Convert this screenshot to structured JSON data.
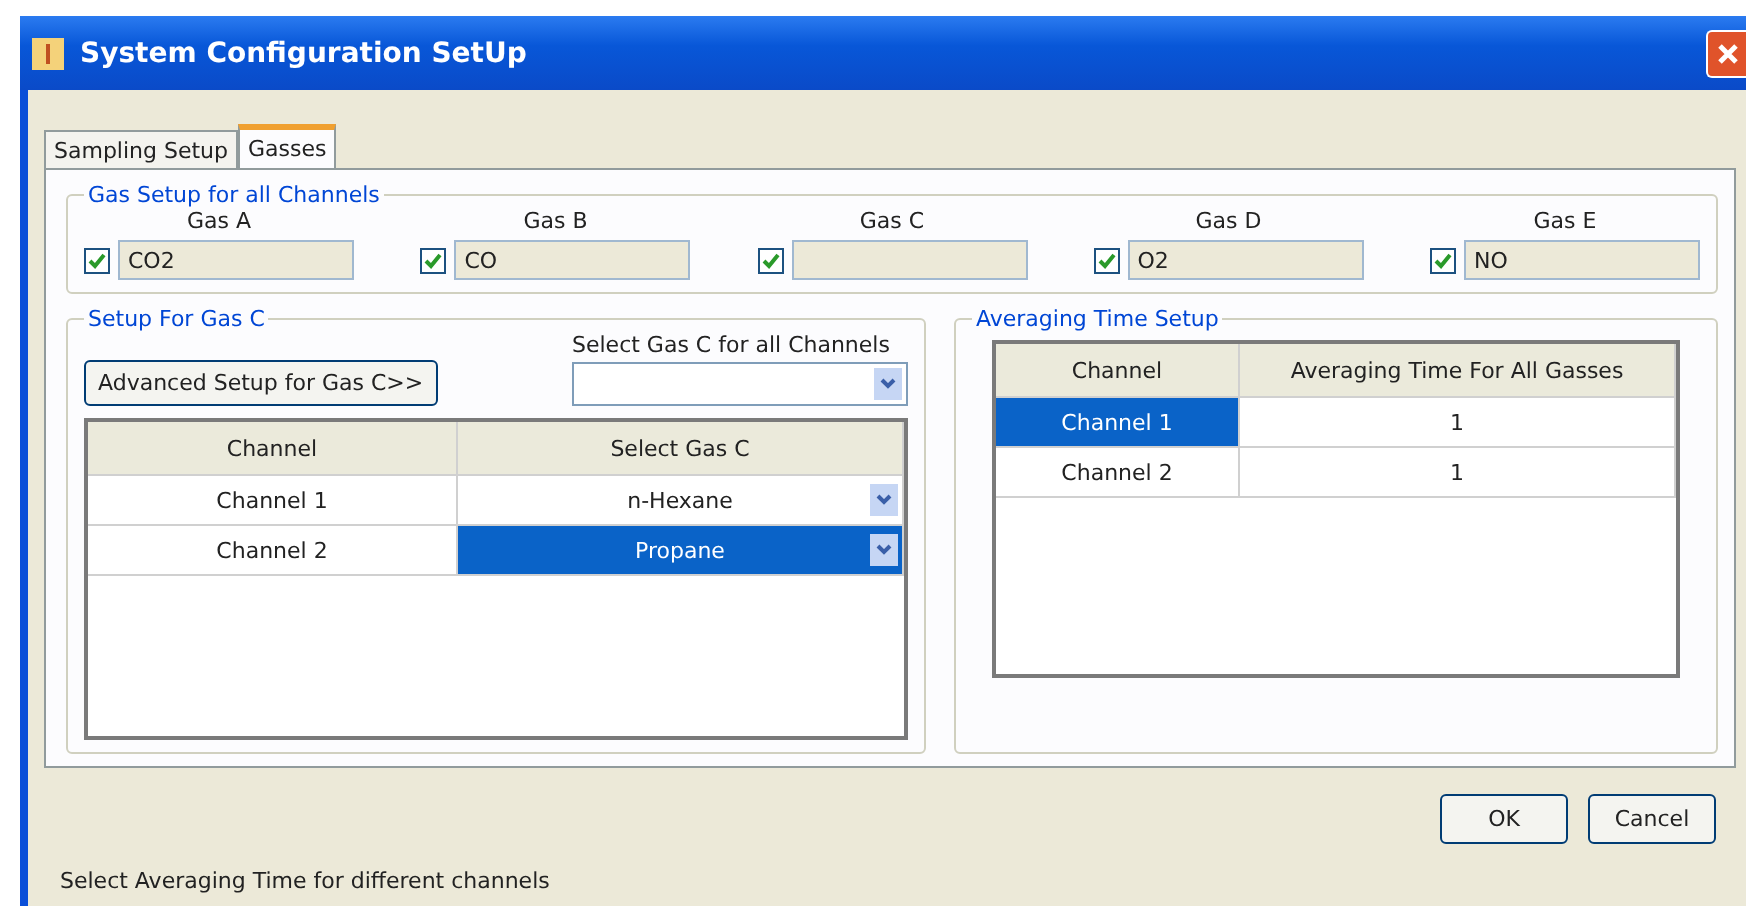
{
  "window": {
    "title": "System Configuration SetUp"
  },
  "tabs": [
    {
      "label": "Sampling Setup",
      "selected": false
    },
    {
      "label": "Gasses",
      "selected": true
    }
  ],
  "gas_setup": {
    "title": "Gas Setup for all Channels",
    "gases": [
      {
        "label": "Gas A",
        "checked": true,
        "value": "CO2"
      },
      {
        "label": "Gas B",
        "checked": true,
        "value": "CO"
      },
      {
        "label": "Gas C",
        "checked": true
      },
      {
        "label": "Gas D",
        "checked": true,
        "value": "O2"
      },
      {
        "label": "Gas E",
        "checked": true,
        "value": "NO"
      }
    ]
  },
  "gas_c_setup": {
    "title": "Setup For Gas C",
    "advanced_button": "Advanced Setup for Gas C>>",
    "select_all_label": "Select Gas C for all Channels",
    "table": {
      "columns": [
        "Channel",
        "Select Gas C"
      ],
      "rows": [
        {
          "channel": "Channel 1",
          "gas": "n-Hexane",
          "selected": false
        },
        {
          "channel": "Channel 2",
          "gas": "Propane",
          "selected": true
        }
      ]
    }
  },
  "averaging": {
    "title": "Averaging Time Setup",
    "table": {
      "columns": [
        "Channel",
        "Averaging Time For All Gasses"
      ],
      "rows": [
        {
          "channel": "Channel 1",
          "time": "1",
          "selected": true
        },
        {
          "channel": "Channel 2",
          "time": "1",
          "selected": false
        }
      ]
    }
  },
  "buttons": [
    "OK",
    "Cancel"
  ],
  "status_bar": "Select Averaging Time for different channels"
}
